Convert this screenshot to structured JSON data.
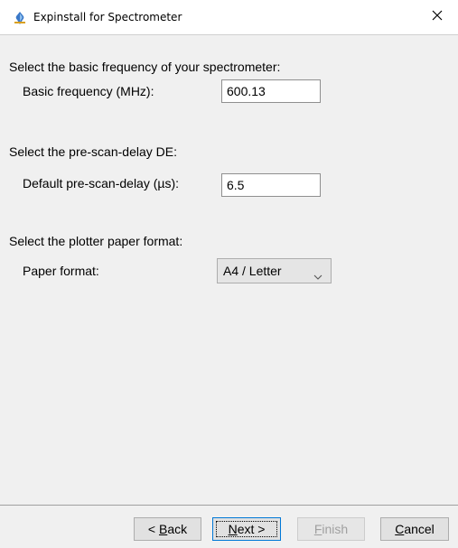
{
  "window": {
    "title": "Expinstall for Spectrometer",
    "close_glyph": "✕",
    "icon": "app-icon"
  },
  "frequency": {
    "section_label": "Select the basic frequency of your spectrometer:",
    "field_label": "Basic frequency (MHz):",
    "value": "600.13"
  },
  "delay": {
    "section_label": "Select the pre-scan-delay DE:",
    "field_label": "Default pre-scan-delay (µs):",
    "value": "6.5"
  },
  "paper": {
    "section_label": "Select the plotter paper format:",
    "field_label": "Paper format:",
    "selected": "A4 / Letter",
    "chevron": "chevron-down-icon"
  },
  "buttons": {
    "back": {
      "prefix": "< ",
      "mnemonic": "B",
      "rest": "ack"
    },
    "next": {
      "mnemonic": "N",
      "rest": "ext >"
    },
    "finish": {
      "mnemonic": "F",
      "rest": "inish"
    },
    "cancel": {
      "mnemonic": "C",
      "rest": "ancel"
    }
  },
  "colors": {
    "dialog_bg": "#f0f0f0",
    "button_bg": "#e1e1e1",
    "default_button_border": "#0078d7",
    "disabled_text": "#a0a0a0"
  }
}
